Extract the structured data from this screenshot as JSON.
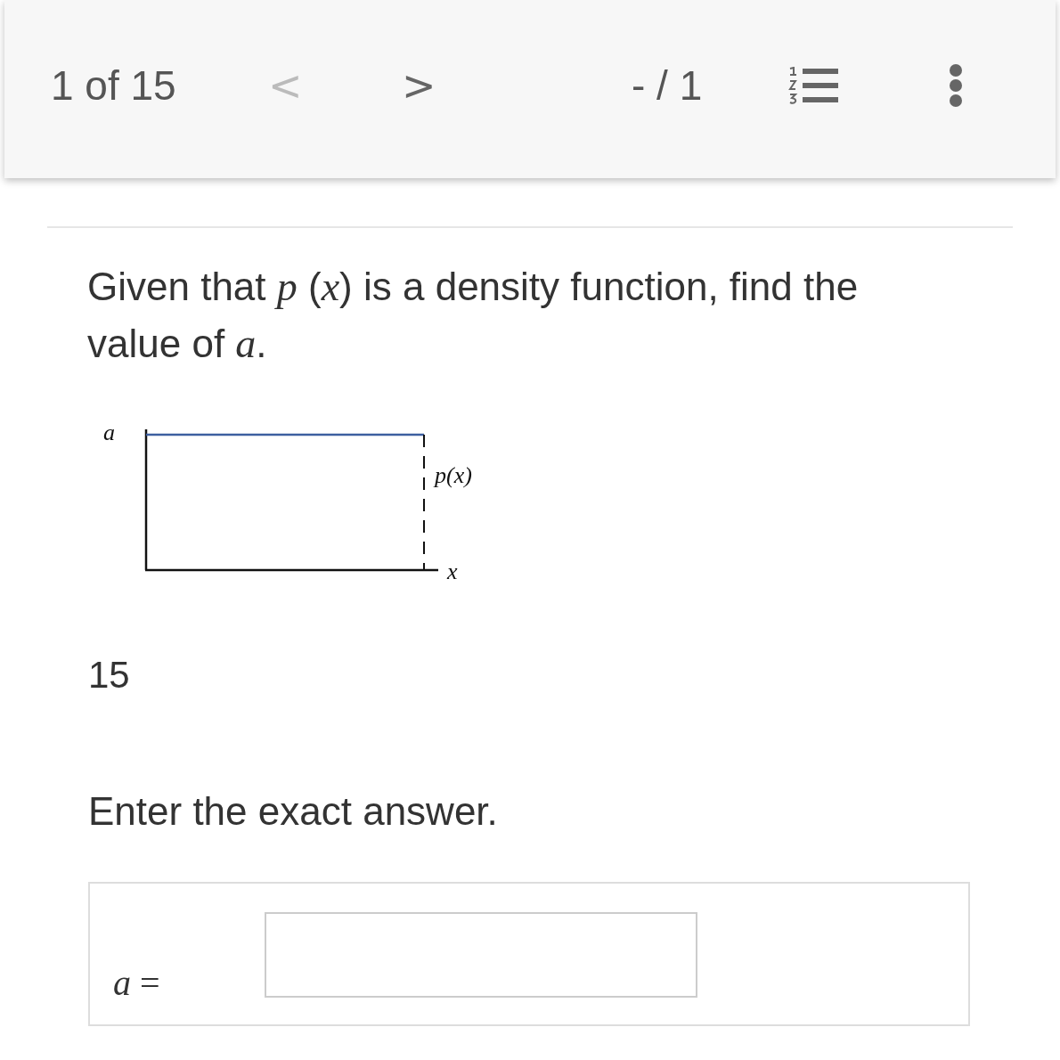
{
  "header": {
    "position": "1 of 15",
    "prev": {
      "label": "<",
      "disabled": true
    },
    "next": {
      "label": ">",
      "disabled": false
    },
    "score": "- / 1"
  },
  "question": {
    "text": "Given that *p* (*x*) is a density function, find the value of *a*.",
    "figure": {
      "y_label": "a",
      "curve_label": "p(x)",
      "x_label": "x"
    },
    "value": "15",
    "instruction": "Enter the exact answer.",
    "answer": {
      "label": "*a* ="
    }
  }
}
